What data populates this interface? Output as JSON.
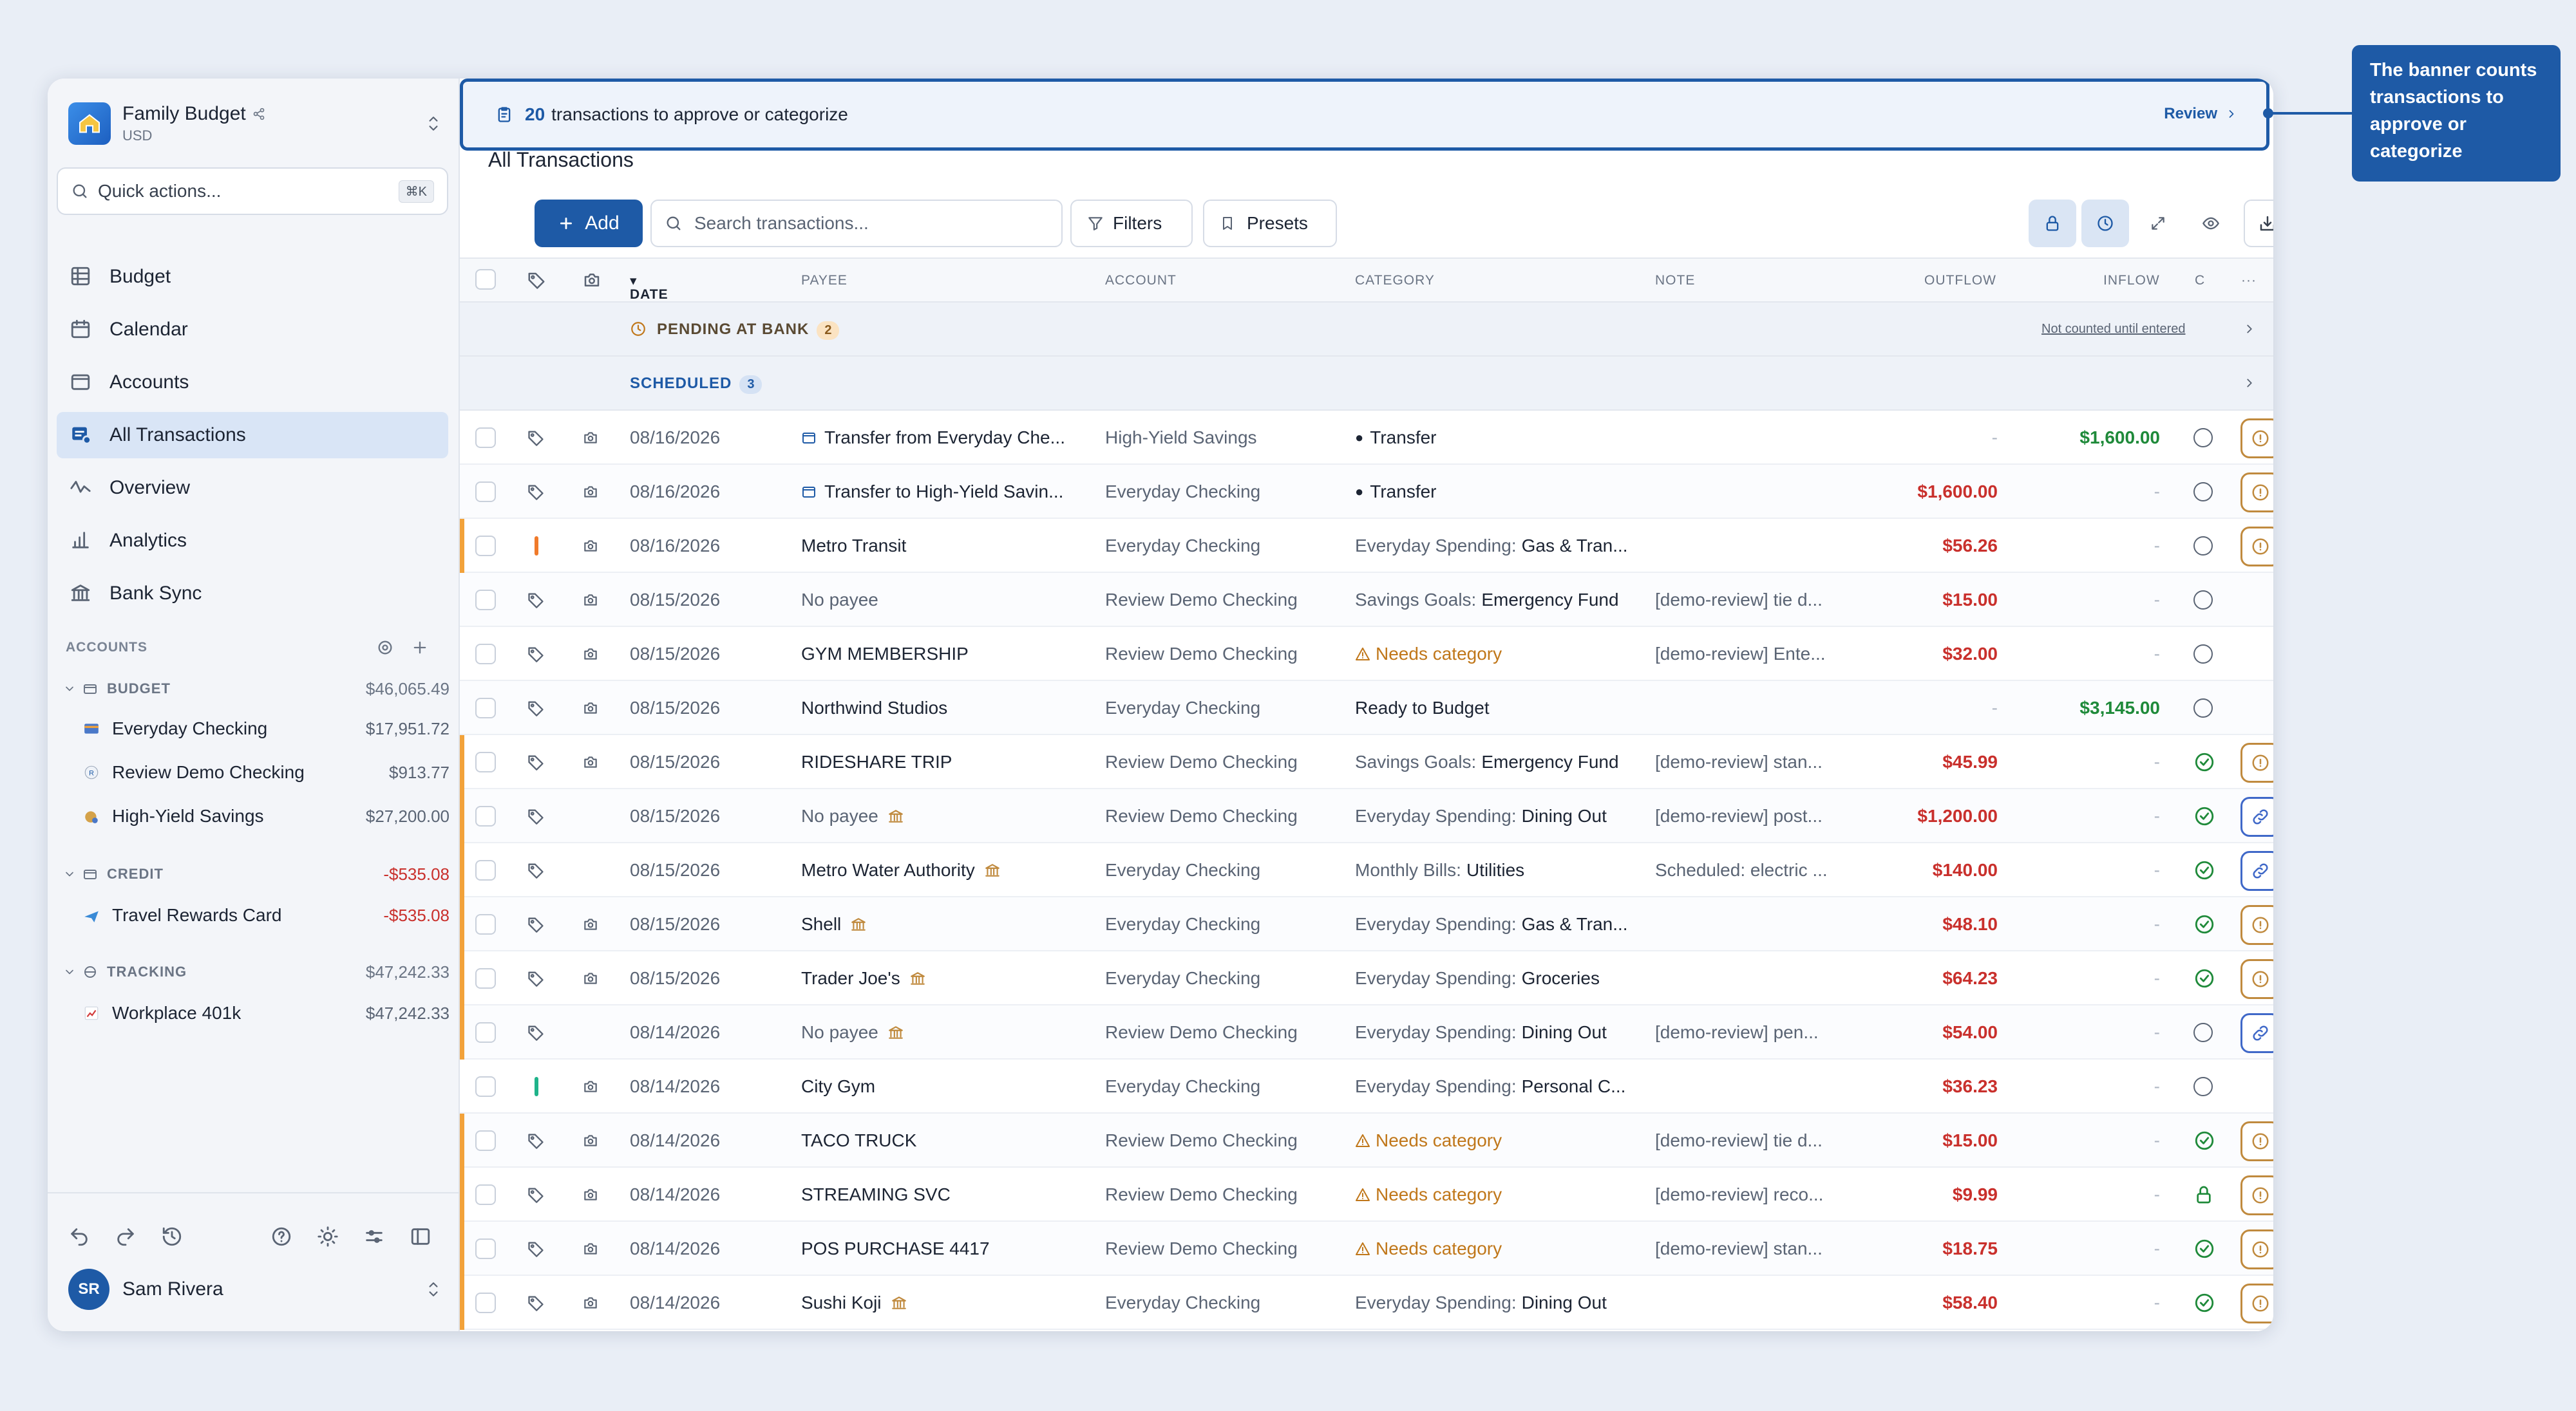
{
  "workspace": {
    "name": "Family Budget",
    "currency": "USD"
  },
  "quick_actions": {
    "placeholder": "Quick actions...",
    "shortcut": "⌘K"
  },
  "nav": [
    {
      "label": "Budget",
      "icon": "grid-icon"
    },
    {
      "label": "Calendar",
      "icon": "calendar-icon"
    },
    {
      "label": "Accounts",
      "icon": "folder-icon"
    },
    {
      "label": "All Transactions",
      "icon": "transactions-icon",
      "active": true
    },
    {
      "label": "Overview",
      "icon": "activity-icon"
    },
    {
      "label": "Analytics",
      "icon": "bar-chart-icon"
    },
    {
      "label": "Bank Sync",
      "icon": "bank-icon"
    }
  ],
  "accounts_section": {
    "label": "ACCOUNTS",
    "groups": [
      {
        "name": "BUDGET",
        "total": "$46,065.49",
        "accounts": [
          {
            "name": "Everyday Checking",
            "balance": "$17,951.72"
          },
          {
            "name": "Review Demo Checking",
            "balance": "$913.77"
          },
          {
            "name": "High-Yield Savings",
            "balance": "$27,200.00"
          }
        ]
      },
      {
        "name": "CREDIT",
        "total": "-$535.08",
        "accounts": [
          {
            "name": "Travel Rewards Card",
            "balance": "-$535.08"
          }
        ]
      },
      {
        "name": "TRACKING",
        "total": "$47,242.33",
        "accounts": [
          {
            "name": "Workplace 401k",
            "balance": "$47,242.33"
          }
        ]
      }
    ]
  },
  "user": {
    "initials": "SR",
    "name": "Sam Rivera"
  },
  "banner": {
    "count": "20",
    "text": "transactions to approve or categorize",
    "action": "Review"
  },
  "page_title": "All Transactions",
  "toolbar": {
    "add": "Add",
    "search_placeholder": "Search transactions...",
    "filters": "Filters",
    "presets": "Presets"
  },
  "columns": {
    "date": "DATE",
    "payee": "PAYEE",
    "account": "ACCOUNT",
    "category": "CATEGORY",
    "note": "NOTE",
    "outflow": "OUTFLOW",
    "inflow": "INFLOW",
    "cleared": "C",
    "more": "···"
  },
  "pending": {
    "label": "PENDING AT BANK",
    "count": "2",
    "note": "Not counted until entered"
  },
  "scheduled": {
    "label": "SCHEDULED",
    "count": "3"
  },
  "transactions": [
    {
      "date": "08/16/2026",
      "payee": "Transfer from Everyday Che...",
      "account": "High-Yield Savings",
      "cat_group": "",
      "cat": "Transfer",
      "note": "",
      "outflow": "-",
      "inflow": "$1,600.00"
    },
    {
      "date": "08/16/2026",
      "payee": "Transfer to High-Yield Savin...",
      "account": "Everyday Checking",
      "cat_group": "",
      "cat": "Transfer",
      "note": "",
      "outflow": "$1,600.00",
      "inflow": "-"
    },
    {
      "date": "08/16/2026",
      "payee": "Metro Transit",
      "account": "Everyday Checking",
      "cat_group": "Everyday Spending:",
      "cat": "Gas & Tran...",
      "note": "",
      "outflow": "$56.26",
      "inflow": "-"
    },
    {
      "date": "08/15/2026",
      "payee": "No payee",
      "account": "Review Demo Checking",
      "cat_group": "Savings Goals:",
      "cat": "Emergency Fund",
      "note": "[demo-review] tie d...",
      "outflow": "$15.00",
      "inflow": "-"
    },
    {
      "date": "08/15/2026",
      "payee": "GYM MEMBERSHIP",
      "account": "Review Demo Checking",
      "cat_group": "",
      "cat": "Needs category",
      "note": "[demo-review] Ente...",
      "outflow": "$32.00",
      "inflow": "-"
    },
    {
      "date": "08/15/2026",
      "payee": "Northwind Studios",
      "account": "Everyday Checking",
      "cat_group": "",
      "cat": "Ready to Budget",
      "note": "",
      "outflow": "-",
      "inflow": "$3,145.00"
    },
    {
      "date": "08/15/2026",
      "payee": "RIDESHARE TRIP",
      "account": "Review Demo Checking",
      "cat_group": "Savings Goals:",
      "cat": "Emergency Fund",
      "note": "[demo-review] stan...",
      "outflow": "$45.99",
      "inflow": "-"
    },
    {
      "date": "08/15/2026",
      "payee": "No payee",
      "account": "Review Demo Checking",
      "cat_group": "Everyday Spending:",
      "cat": "Dining Out",
      "note": "[demo-review] post...",
      "outflow": "$1,200.00",
      "inflow": "-"
    },
    {
      "date": "08/15/2026",
      "payee": "Metro Water Authority",
      "account": "Everyday Checking",
      "cat_group": "Monthly Bills:",
      "cat": "Utilities",
      "note": "Scheduled: electric ...",
      "outflow": "$140.00",
      "inflow": "-"
    },
    {
      "date": "08/15/2026",
      "payee": "Shell",
      "account": "Everyday Checking",
      "cat_group": "Everyday Spending:",
      "cat": "Gas & Tran...",
      "note": "",
      "outflow": "$48.10",
      "inflow": "-"
    },
    {
      "date": "08/15/2026",
      "payee": "Trader Joe's",
      "account": "Everyday Checking",
      "cat_group": "Everyday Spending:",
      "cat": "Groceries",
      "note": "",
      "outflow": "$64.23",
      "inflow": "-"
    },
    {
      "date": "08/14/2026",
      "payee": "No payee",
      "account": "Review Demo Checking",
      "cat_group": "Everyday Spending:",
      "cat": "Dining Out",
      "note": "[demo-review] pen...",
      "outflow": "$54.00",
      "inflow": "-"
    },
    {
      "date": "08/14/2026",
      "payee": "City Gym",
      "account": "Everyday Checking",
      "cat_group": "Everyday Spending:",
      "cat": "Personal C...",
      "note": "",
      "outflow": "$36.23",
      "inflow": "-"
    },
    {
      "date": "08/14/2026",
      "payee": "TACO TRUCK",
      "account": "Review Demo Checking",
      "cat_group": "",
      "cat": "Needs category",
      "note": "[demo-review] tie d...",
      "outflow": "$15.00",
      "inflow": "-"
    },
    {
      "date": "08/14/2026",
      "payee": "STREAMING SVC",
      "account": "Review Demo Checking",
      "cat_group": "",
      "cat": "Needs category",
      "note": "[demo-review] reco...",
      "outflow": "$9.99",
      "inflow": "-"
    },
    {
      "date": "08/14/2026",
      "payee": "POS PURCHASE 4417",
      "account": "Review Demo Checking",
      "cat_group": "",
      "cat": "Needs category",
      "note": "[demo-review] stan...",
      "outflow": "$18.75",
      "inflow": "-"
    },
    {
      "date": "08/14/2026",
      "payee": "Sushi Koji",
      "account": "Everyday Checking",
      "cat_group": "Everyday Spending:",
      "cat": "Dining Out",
      "note": "",
      "outflow": "$58.40",
      "inflow": "-"
    }
  ],
  "callout": {
    "text": "The banner counts transactions to approve or categorize"
  },
  "colors": {
    "accent": "#1e5aa6",
    "negative": "#c9302c",
    "positive": "#1f8a3a",
    "warning": "#c0771a",
    "review_stripe": "#f2a23a"
  }
}
